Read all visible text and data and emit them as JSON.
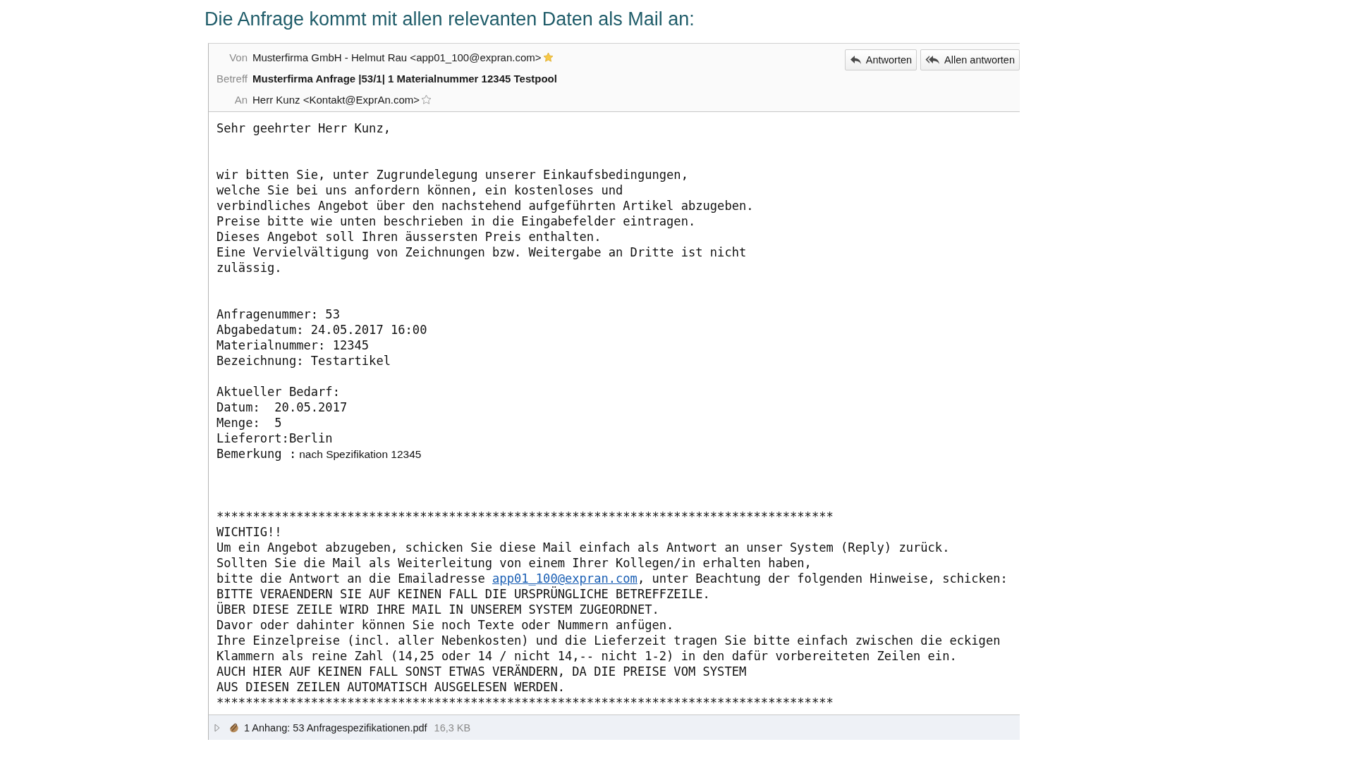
{
  "heading": "Die Anfrage kommt mit allen relevanten Daten als Mail an:",
  "mail": {
    "header": [
      {
        "label": "Von",
        "value": "Musterfirma GmbH - Helmut Rau <app01_100@expran.com>",
        "bold": false,
        "starred": true
      },
      {
        "label": "Betreff",
        "value": "Musterfirma Anfrage |53/1| 1 Materialnummer 12345 Testpool",
        "bold": true
      },
      {
        "label": "An",
        "value": "Herr Kunz <Kontakt@ExprAn.com>",
        "bold": false,
        "starred": false
      }
    ],
    "buttons": [
      {
        "label": "Antworten",
        "kind": "reply"
      },
      {
        "label": "Allen antworten",
        "kind": "reply-all"
      }
    ],
    "body": [
      {
        "kind": "greeting",
        "lines": [
          {
            "text": "Sehr geehrter Herr Kunz,"
          }
        ]
      },
      {
        "kind": "paragraph",
        "lines": [
          {
            "text": "wir bitten Sie, unter Zugrundelegung unserer Einkaufsbedingungen,"
          },
          {
            "text": "welche Sie bei uns anfordern können, ein kostenloses und"
          },
          {
            "text": "verbindliches Angebot über den nachstehend aufgeführten Artikel abzugeben."
          },
          {
            "text": "Preise bitte wie unten beschrieben in die Eingabefelder eintragen."
          },
          {
            "text": "Dieses Angebot soll Ihren äussersten Preis enthalten."
          },
          {
            "text": "Eine Vervielvältigung von Zeichnungen bzw. Weitergabe an Dritte ist nicht"
          },
          {
            "text": "zulässig."
          }
        ]
      },
      {
        "kind": "fields",
        "lines": [
          {
            "text": "Anfragenummer: 53"
          },
          {
            "text": "Abgabedatum: 24.05.2017 16:00"
          },
          {
            "text": "Materialnummer: 12345"
          },
          {
            "text": "Bezeichnung: Testartikel"
          }
        ]
      },
      {
        "kind": "demand",
        "lines": [
          {
            "text": "Aktueller Bedarf:"
          },
          {
            "text": "Datum:  20.05.2017"
          },
          {
            "text": "Menge:  5"
          },
          {
            "text": "Lieferort:Berlin"
          },
          {
            "text": "Bemerkung :",
            "note": "nach Spezifikation 12345"
          }
        ]
      },
      {
        "kind": "notice",
        "lines": [
          {
            "text": "*************************************************************************************"
          },
          {
            "text": "WICHTIG!!"
          },
          {
            "text": "Um ein Angebot abzugeben, schicken Sie diese Mail einfach als Antwort an unser System (Reply) zurück."
          },
          {
            "text": "Sollten Sie die Mail als Weiterleitung von einem Ihrer Kollegen/in erhalten haben,"
          },
          {
            "text": "bitte die Antwort an die Emailadresse ",
            "link": "app01_100@expran.com",
            "after": ", unter Beachtung der folgenden Hinweise, schicken:"
          },
          {
            "text": "BITTE VERAENDERN SIE AUF KEINEN FALL DIE URSPRÜNGLICHE BETREFFZEILE."
          },
          {
            "text": "ÜBER DIESE ZEILE WIRD IHRE MAIL IN UNSEREM SYSTEM ZUGEORDNET."
          },
          {
            "text": "Davor oder dahinter können Sie noch Texte oder Nummern anfügen."
          },
          {
            "text": "Ihre Einzelpreise (incl. aller Nebenkosten) und die Lieferzeit tragen Sie bitte einfach zwischen die eckigen"
          },
          {
            "text": "Klammern als reine Zahl (14,25 oder 14 / nicht 14,-- nicht 1-2) in den dafür vorbereiteten Zeilen ein."
          },
          {
            "text": "AUCH HIER AUF KEINEN FALL SONST ETWAS VERÄNDERN, DA DIE PREISE VOM SYSTEM"
          },
          {
            "text": "AUS DIESEN ZEILEN AUTOMATISCH AUSGELESEN WERDEN."
          },
          {
            "text": "*************************************************************************************"
          }
        ]
      }
    ],
    "attachment": {
      "expanded": false,
      "label": "1 Anhang: 53 Anfragespezifikationen.pdf",
      "size": "16,3 KB"
    }
  }
}
